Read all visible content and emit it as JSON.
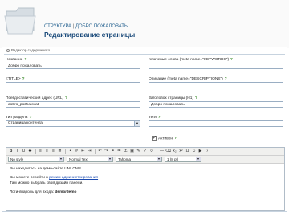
{
  "header": {
    "breadcrumb_section": "СТРУКТУРА",
    "breadcrumb_sep": "|",
    "breadcrumb_page": "ДОБРО ПОЖАЛОВАТЬ",
    "title": "Редактирование страницы"
  },
  "main_tab": {
    "label": "Редактор содержимого"
  },
  "fields": {
    "name": {
      "label": "Название",
      "value": "Добро пожаловать"
    },
    "keywords": {
      "label": "Ключевые слова (meta name=\"KEYWORDS\")",
      "value": ""
    },
    "title_tag": {
      "label": "<TITLE>",
      "value": ""
    },
    "description": {
      "label": "Описание (meta name=\"DESCRIPTIONS\")",
      "value": ""
    },
    "url": {
      "label": "Псевдостатический адрес (URL)",
      "value": "dobro_pozhalovat"
    },
    "h1": {
      "label": "Заголовок страницы (H1)",
      "value": "Добро пожаловать"
    },
    "section_type": {
      "label": "Тип раздела",
      "value": "Страница контента"
    },
    "tags": {
      "label": "Теги",
      "value": ""
    },
    "active": {
      "label": "Активен"
    }
  },
  "editor": {
    "style_select": "No style",
    "format_select": "Normal Text",
    "font_select": "Tahoma",
    "size_select": "1 (8 pt)",
    "line1": "Вы находитесь на демо-сайте UMI.CMS",
    "line2_prefix": "Вы можете перейти в ",
    "line2_link": "режим администрирования",
    "line3": "Там можно выбрать свой дизайн панели.",
    "line4_prefix": "Логин/пароль для входа: ",
    "line4_bold": "demo/demo"
  },
  "colors": {
    "link": "#1a4ab0",
    "title": "#1a4a7a",
    "help": "#3a8a2a"
  }
}
